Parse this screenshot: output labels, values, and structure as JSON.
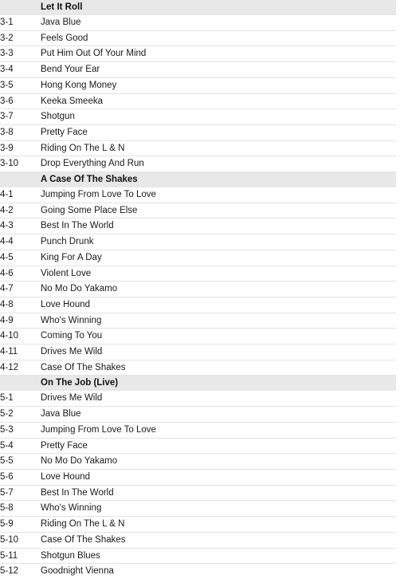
{
  "tracklist": {
    "sections": [
      {
        "heading": "Let It Roll",
        "tracks": [
          {
            "position": "3-1",
            "title": "Java Blue"
          },
          {
            "position": "3-2",
            "title": "Feels Good"
          },
          {
            "position": "3-3",
            "title": "Put Him Out Of Your Mind"
          },
          {
            "position": "3-4",
            "title": "Bend Your Ear"
          },
          {
            "position": "3-5",
            "title": "Hong Kong Money"
          },
          {
            "position": "3-6",
            "title": "Keeka Smeeka"
          },
          {
            "position": "3-7",
            "title": "Shotgun"
          },
          {
            "position": "3-8",
            "title": "Pretty Face"
          },
          {
            "position": "3-9",
            "title": "Riding On The L & N"
          },
          {
            "position": "3-10",
            "title": "Drop Everything And Run"
          }
        ]
      },
      {
        "heading": "A Case Of The Shakes",
        "tracks": [
          {
            "position": "4-1",
            "title": "Jumping From Love To Love"
          },
          {
            "position": "4-2",
            "title": "Going Some Place Else"
          },
          {
            "position": "4-3",
            "title": "Best In The World"
          },
          {
            "position": "4-4",
            "title": "Punch Drunk"
          },
          {
            "position": "4-5",
            "title": "King For A Day"
          },
          {
            "position": "4-6",
            "title": "Violent Love"
          },
          {
            "position": "4-7",
            "title": "No Mo Do Yakamo"
          },
          {
            "position": "4-8",
            "title": "Love Hound"
          },
          {
            "position": "4-9",
            "title": "Who's Winning"
          },
          {
            "position": "4-10",
            "title": "Coming To You"
          },
          {
            "position": "4-11",
            "title": "Drives Me Wild"
          },
          {
            "position": "4-12",
            "title": "Case Of The Shakes"
          }
        ]
      },
      {
        "heading": "On The Job (Live)",
        "tracks": [
          {
            "position": "5-1",
            "title": "Drives Me Wild"
          },
          {
            "position": "5-2",
            "title": "Java Blue"
          },
          {
            "position": "5-3",
            "title": "Jumping From Love To Love"
          },
          {
            "position": "5-4",
            "title": "Pretty Face"
          },
          {
            "position": "5-5",
            "title": "No Mo Do Yakamo"
          },
          {
            "position": "5-6",
            "title": "Love Hound"
          },
          {
            "position": "5-7",
            "title": "Best In The World"
          },
          {
            "position": "5-8",
            "title": "Who's Winning"
          },
          {
            "position": "5-9",
            "title": "Riding On The L & N"
          },
          {
            "position": "5-10",
            "title": "Case Of The Shakes"
          },
          {
            "position": "5-11",
            "title": "Shotgun Blues"
          },
          {
            "position": "5-12",
            "title": "Goodnight Vienna"
          }
        ]
      }
    ]
  },
  "colors": {
    "section_header_bg": "#e8e8e8",
    "row_divider": "#e3e3e3",
    "text": "#1a1a1a",
    "page_bg": "#ffffff"
  }
}
